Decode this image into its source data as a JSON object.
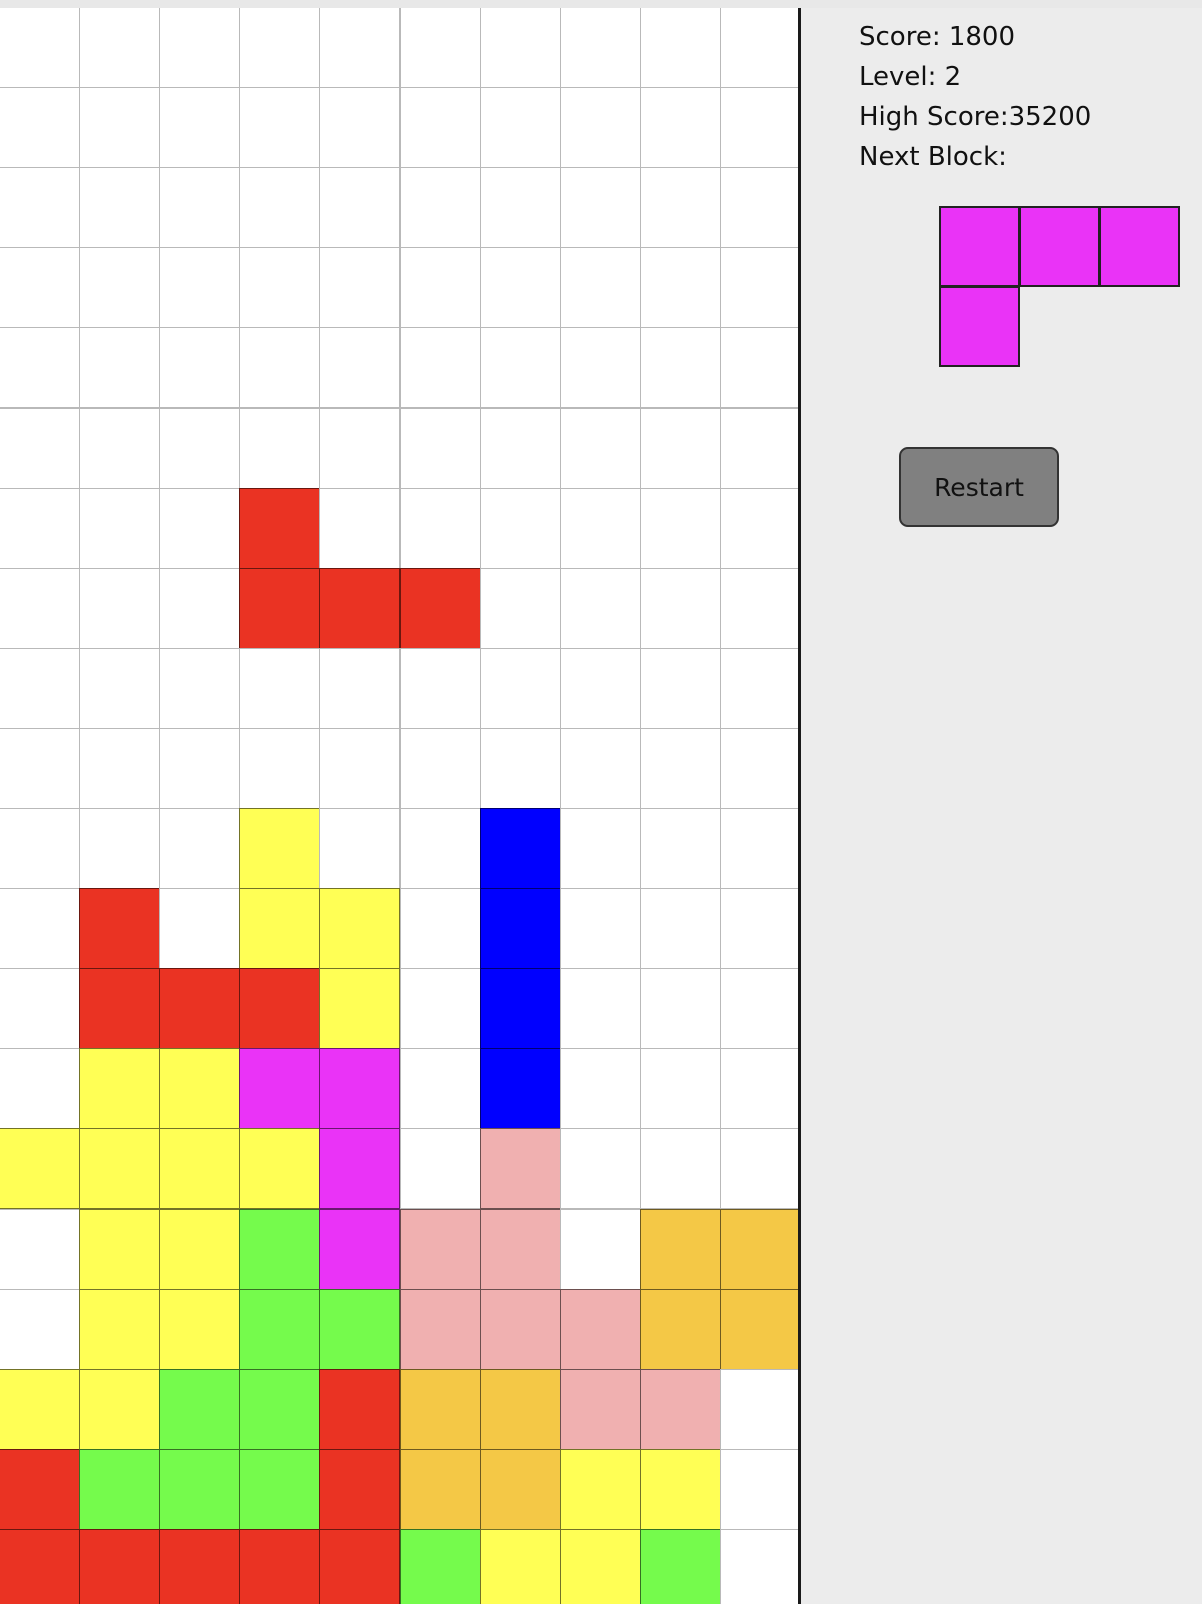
{
  "stats": {
    "score_text": "Score: 1800",
    "level_text": "Level: 2",
    "high_score_text": "High Score:35200",
    "next_block_label": "Next Block:"
  },
  "restart_label": "Restart",
  "colors": {
    "R": "#ea3323",
    "Y": "#ffff55",
    "B": "#0000ff",
    "M": "#ea33f7",
    "G": "#75fb4c",
    "P": "#f0b0b0",
    "O": "#f4c846",
    "empty": "#ffffff",
    "gridline": "#b9b9b9",
    "panel": "#ececec",
    "button": "#808080"
  },
  "board": {
    "columns": 10,
    "rows": 20,
    "active_piece": {
      "color": "R",
      "cells": [
        [
          3,
          6
        ],
        [
          3,
          7
        ],
        [
          4,
          7
        ],
        [
          5,
          7
        ]
      ]
    },
    "grid": [
      "..........",
      "..........",
      "..........",
      "..........",
      "..........",
      "..........",
      "..........",
      "..........",
      "..........",
      "..........",
      "...Y..B...",
      ".R.YY.B...",
      ".RRRY.B...",
      ".YYMM.B...",
      "YYYYM.P...",
      ".YYGMPP.OO",
      ".YYGGPPPOO",
      "YYGGROOPP.",
      "RGGGROOYY.",
      "RRRRRGYYG."
    ]
  },
  "next_block": {
    "color": "M",
    "cells": [
      [
        0,
        0
      ],
      [
        1,
        0
      ],
      [
        2,
        0
      ],
      [
        0,
        1
      ]
    ]
  }
}
